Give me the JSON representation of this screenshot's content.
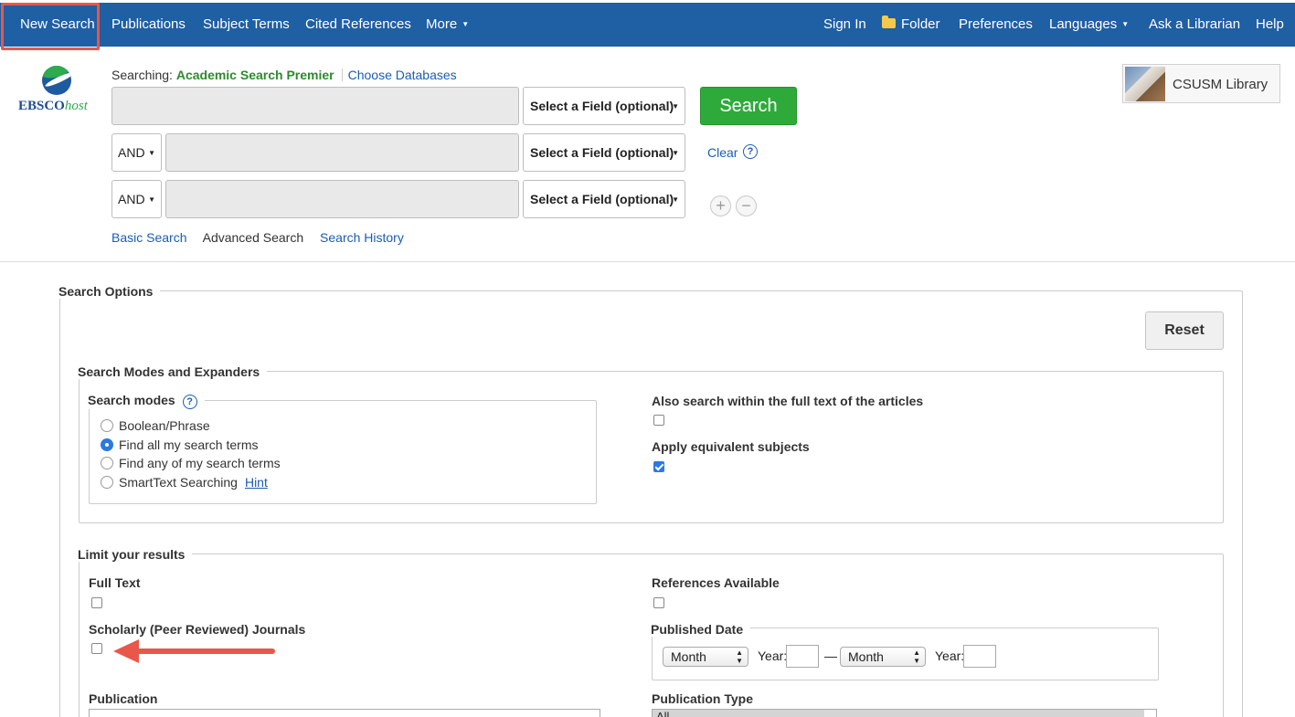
{
  "nav": {
    "left": [
      "New Search",
      "Publications",
      "Subject Terms",
      "Cited References",
      "More"
    ],
    "right": [
      "Sign In",
      "Folder",
      "Preferences",
      "Languages",
      "Ask a Librarian",
      "Help"
    ]
  },
  "logo": {
    "brand": "EBSCO",
    "host": "host"
  },
  "search": {
    "searching_label": "Searching:",
    "database": "Academic Search Premier",
    "choose_databases": "Choose Databases",
    "field_placeholder": "Select a Field (optional)",
    "bool_op": "AND",
    "search_button": "Search",
    "clear": "Clear",
    "help": "?",
    "add": "+",
    "remove": "−",
    "modes": {
      "basic": "Basic Search",
      "advanced": "Advanced Search",
      "history": "Search History"
    }
  },
  "library": {
    "name": "CSUSM Library"
  },
  "options": {
    "title": "Search Options",
    "reset": "Reset",
    "modes_expanders": {
      "title": "Search Modes and Expanders",
      "search_modes": "Search modes",
      "radios": [
        {
          "label": "Boolean/Phrase",
          "checked": false
        },
        {
          "label": "Find all my search terms",
          "checked": true
        },
        {
          "label": "Find any of my search terms",
          "checked": false
        },
        {
          "label": "SmartText Searching",
          "checked": false
        }
      ],
      "hint": "Hint",
      "also_search": "Also search within the full text of the articles",
      "apply_equivalent": "Apply equivalent subjects"
    },
    "limits": {
      "title": "Limit your results",
      "full_text": "Full Text",
      "references": "References Available",
      "scholarly": "Scholarly (Peer Reviewed) Journals",
      "published_date": "Published Date",
      "month": "Month",
      "year": "Year:",
      "dash": "—",
      "publication": "Publication",
      "publication_type": "Publication Type",
      "pubtype_first": "All"
    }
  },
  "colors": {
    "nav_bg": "#1f5fa3",
    "search_green": "#2eaa3a",
    "highlight": "#e8574a",
    "link": "#1a5db4"
  }
}
